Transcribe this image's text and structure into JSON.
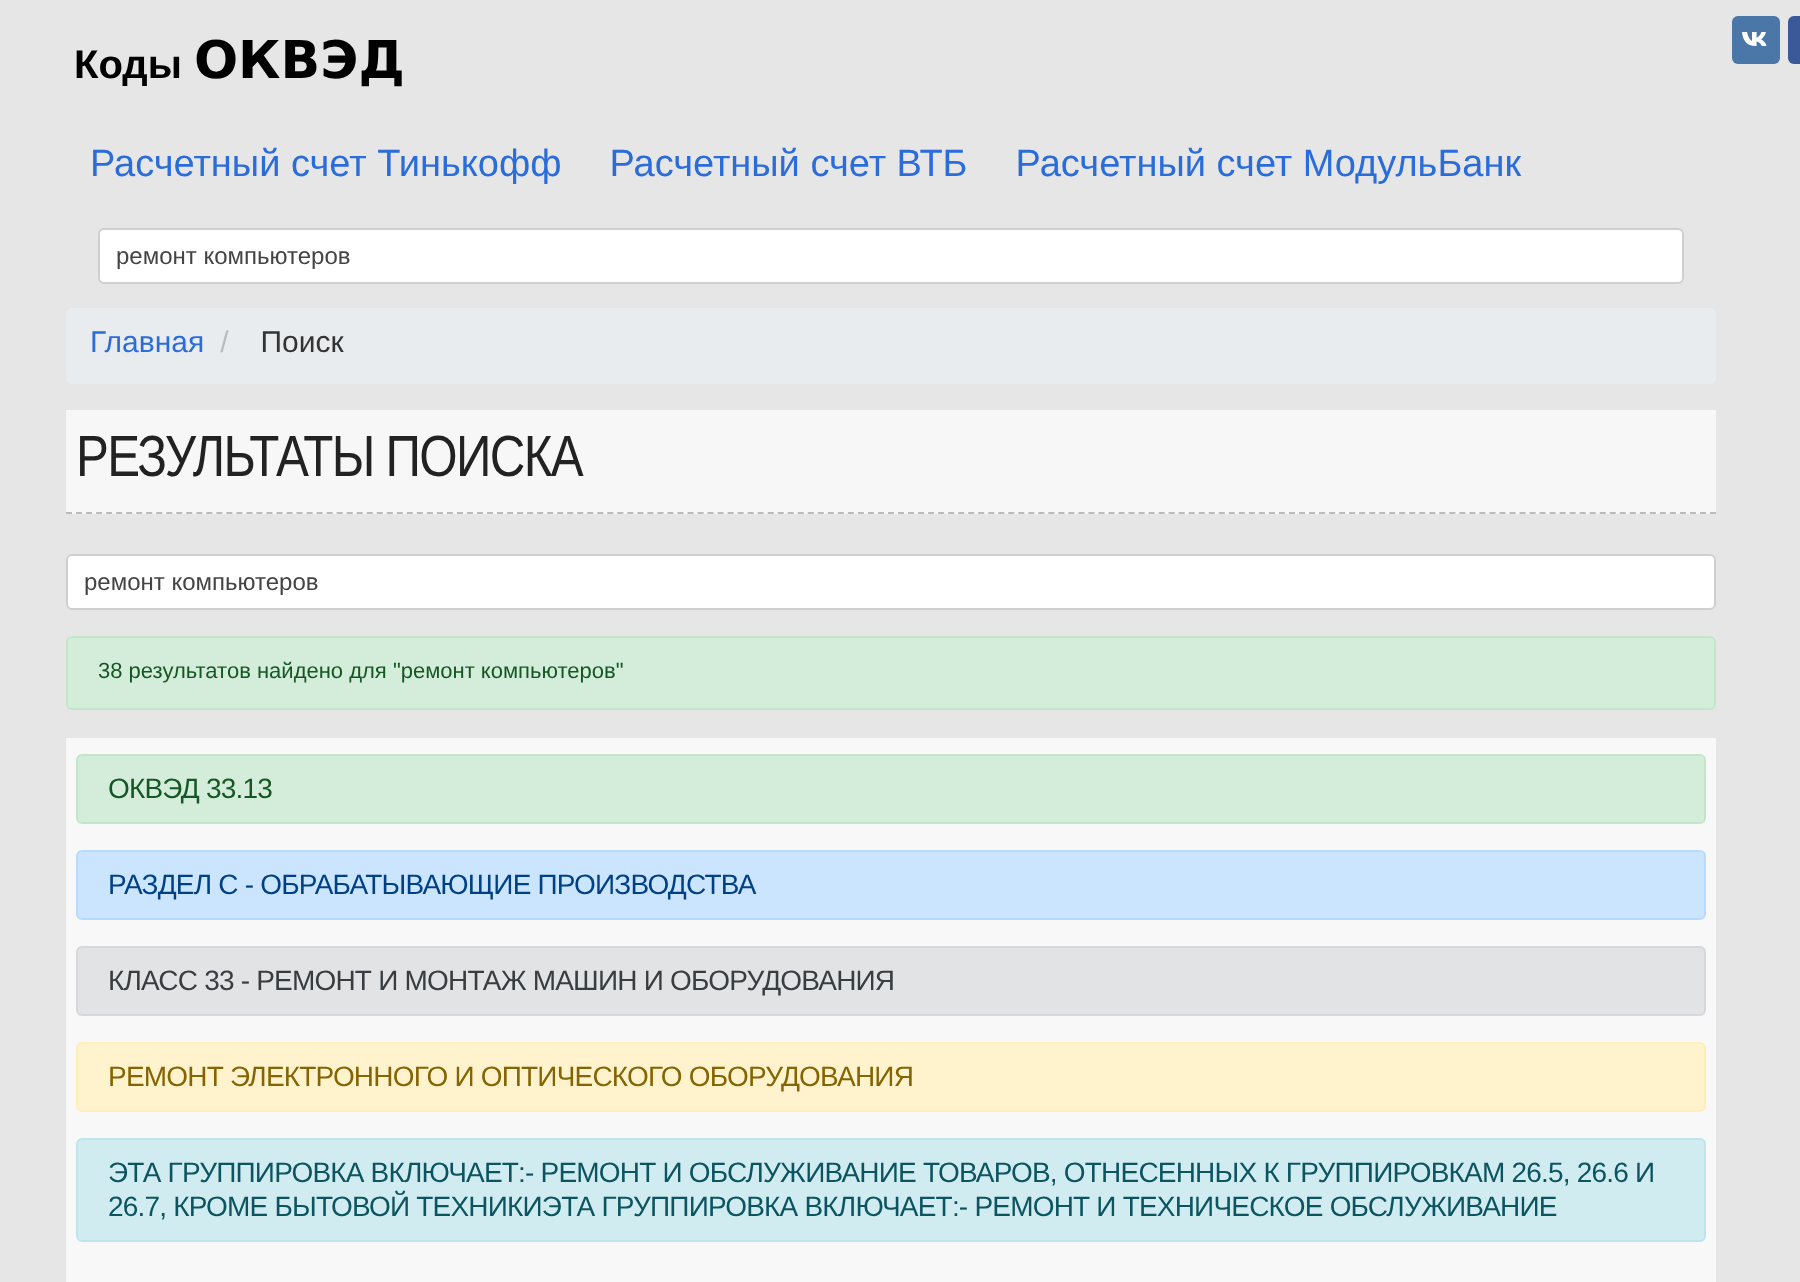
{
  "site_title": {
    "prefix": "Коды",
    "name": "ОКВЭД"
  },
  "nav_links": [
    "Расчетный счет Тинькофф",
    "Расчетный счет ВТБ",
    "Расчетный счет МодульБанк"
  ],
  "top_search": {
    "value": "ремонт компьютеров"
  },
  "breadcrumb_separator": "/",
  "breadcrumb": [
    {
      "label": "Главная",
      "kind": "link"
    },
    {
      "label": "Поиск",
      "kind": "current"
    }
  ],
  "page_heading": "РЕЗУЛЬТАТЫ ПОИСКА",
  "search": {
    "value": "ремонт компьютеров"
  },
  "result_notice": "38 результатов найдено для \"ремонт компьютеров\"",
  "results": [
    {
      "kind": "success",
      "text": "ОКВЭД 33.13"
    },
    {
      "kind": "primary",
      "text": "РАЗДЕЛ C - ОБРАБАТЫВАЮЩИЕ ПРОИЗВОДСТВА"
    },
    {
      "kind": "secondary",
      "text": "КЛАСС 33 - РЕМОНТ И МОНТАЖ МАШИН И ОБОРУДОВАНИЯ"
    },
    {
      "kind": "warning",
      "text": "РЕМОНТ ЭЛЕКТРОННОГО И ОПТИЧЕСКОГО ОБОРУДОВАНИЯ"
    },
    {
      "kind": "info",
      "text": "ЭТА ГРУППИРОВКА ВКЛЮЧАЕТ:- РЕМОНТ И ОБСЛУЖИВАНИЕ ТОВАРОВ, ОТНЕСЕННЫХ К ГРУППИРОВКАМ 26.5, 26.6 И 26.7, КРОМЕ БЫТОВОЙ ТЕХНИКИЭТА ГРУППИРОВКА ВКЛЮЧАЕТ:- РЕМОНТ И ТЕХНИЧЕСКОЕ ОБСЛУЖИВАНИЕ"
    }
  ]
}
